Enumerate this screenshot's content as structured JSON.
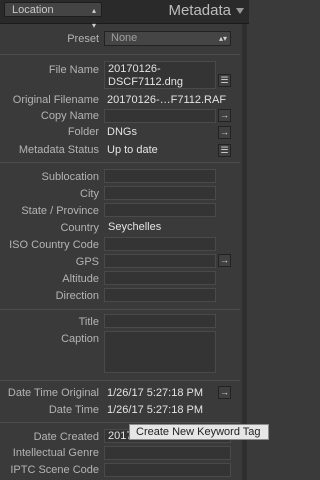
{
  "header": {
    "filter_label": "Location",
    "panel_title": "Metadata"
  },
  "preset": {
    "label": "Preset",
    "value": "None"
  },
  "fields": {
    "file_name": {
      "label": "File Name",
      "value_line1": "20170126-",
      "value_line2": "DSCF7112.dng"
    },
    "original_filename": {
      "label": "Original Filename",
      "value": "20170126-…F7112.RAF"
    },
    "copy_name": {
      "label": "Copy Name",
      "value": ""
    },
    "folder": {
      "label": "Folder",
      "value": "DNGs"
    },
    "metadata_status": {
      "label": "Metadata Status",
      "value": "Up to date"
    },
    "sublocation": {
      "label": "Sublocation",
      "value": ""
    },
    "city": {
      "label": "City",
      "value": ""
    },
    "state_province": {
      "label": "State / Province",
      "value": ""
    },
    "country": {
      "label": "Country",
      "value": "Seychelles"
    },
    "iso_country_code": {
      "label": "ISO Country Code",
      "value": ""
    },
    "gps": {
      "label": "GPS",
      "value": ""
    },
    "altitude": {
      "label": "Altitude",
      "value": ""
    },
    "direction": {
      "label": "Direction",
      "value": ""
    },
    "title": {
      "label": "Title",
      "value": ""
    },
    "caption": {
      "label": "Caption",
      "value": ""
    },
    "date_time_original": {
      "label": "Date Time Original",
      "value": "1/26/17 5:27:18 PM"
    },
    "date_time": {
      "label": "Date Time",
      "value": "1/26/17 5:27:18 PM"
    },
    "date_created": {
      "label": "Date Created",
      "value": "2017-01-26T17:27:18"
    },
    "intellectual_genre": {
      "label": "Intellectual Genre",
      "value": ""
    },
    "iptc_scene_code": {
      "label": "IPTC Scene Code",
      "value": ""
    }
  },
  "tooltip": {
    "text": "Create New Keyword Tag"
  },
  "colors": {
    "panel_bg": "#3a3a3a",
    "field_bg": "#343434",
    "header_bg": "#2a2a2a"
  }
}
